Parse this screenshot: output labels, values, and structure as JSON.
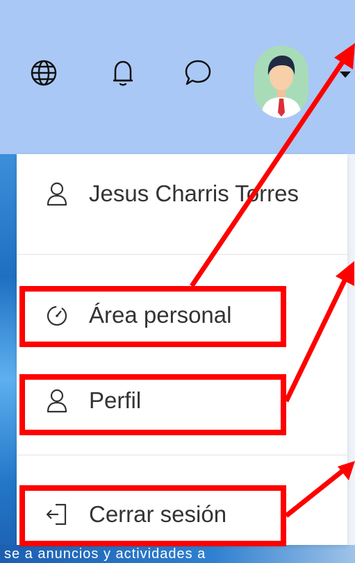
{
  "user": {
    "name": "Jesus Charris Torres"
  },
  "menu": {
    "items": [
      {
        "label": "Área personal",
        "icon": "dashboard-icon"
      },
      {
        "label": "Perfil",
        "icon": "user-icon"
      },
      {
        "label": "Cerrar sesión",
        "icon": "logout-icon"
      }
    ]
  },
  "navbar": {
    "icons": [
      "globe-icon",
      "bell-icon",
      "chat-icon",
      "avatar",
      "caret-down-icon"
    ]
  },
  "background": {
    "partial_text": "se a anuncios y actividades a"
  },
  "colors": {
    "navbar": "#a9c8f5",
    "annotation": "#ff0000",
    "text": "#333333"
  }
}
